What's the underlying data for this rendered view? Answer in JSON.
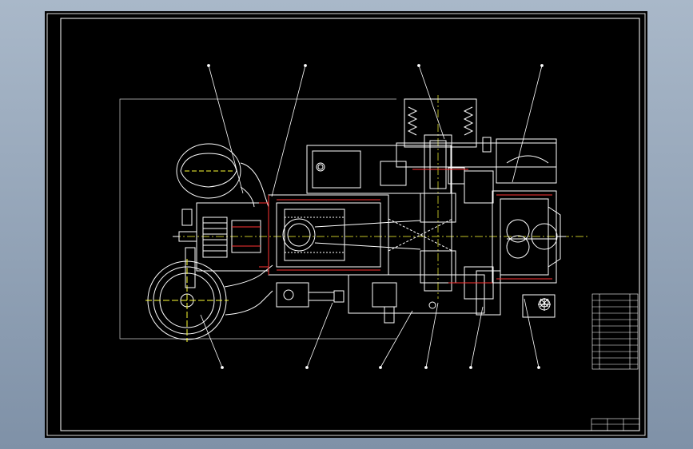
{
  "drawing": {
    "type": "CAD assembly drawing - compressor section view",
    "background": "#000000",
    "line_color": "#ffffff",
    "accent_color": "#ffff00",
    "callout_count_top": 4,
    "callout_count_bottom": 6
  },
  "title_block": {
    "rows": 12,
    "text": ""
  }
}
